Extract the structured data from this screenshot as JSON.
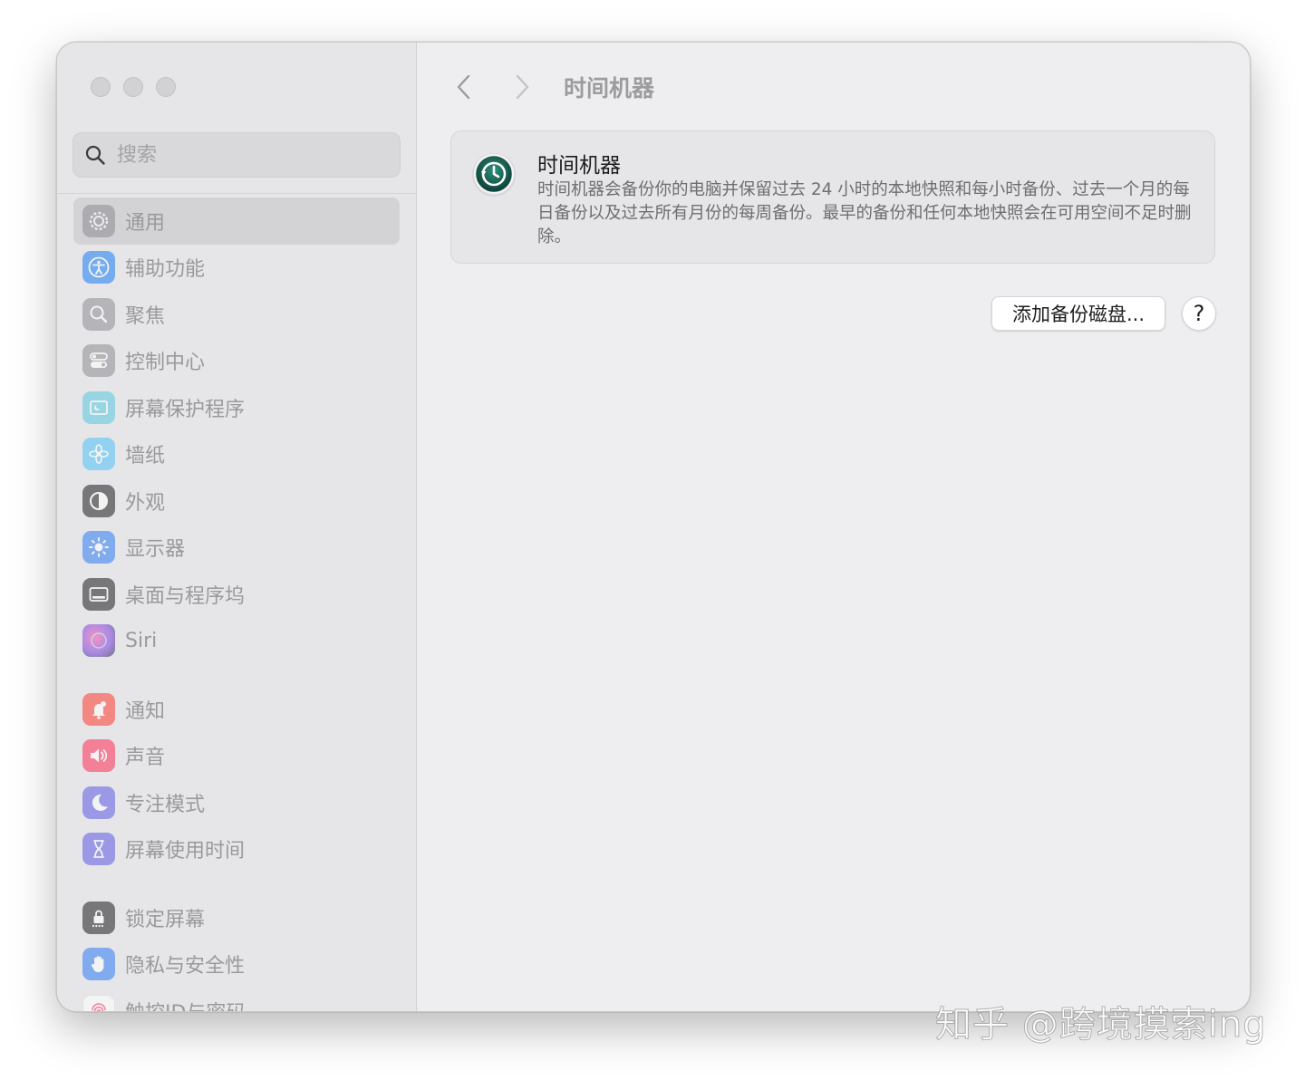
{
  "window": {
    "traffic_lights": [
      "close",
      "minimize",
      "zoom"
    ]
  },
  "search": {
    "placeholder": "搜索",
    "icon": "search-icon"
  },
  "sidebar": {
    "items": [
      {
        "label": "通用",
        "icon": "gear-icon",
        "color": "#8e8e93",
        "active": true
      },
      {
        "label": "辅助功能",
        "icon": "accessibility-icon",
        "color": "#1a7cf5"
      },
      {
        "label": "聚焦",
        "icon": "spotlight-icon",
        "color": "#8e8e93"
      },
      {
        "label": "控制中心",
        "icon": "control-center-icon",
        "color": "#8e8e93"
      },
      {
        "label": "屏幕保护程序",
        "icon": "screensaver-icon",
        "color": "#5ac8e0"
      },
      {
        "label": "墙纸",
        "icon": "wallpaper-icon",
        "color": "#4fc3f7"
      },
      {
        "label": "外观",
        "icon": "appearance-icon",
        "color": "#1d1d1f"
      },
      {
        "label": "显示器",
        "icon": "display-icon",
        "color": "#2f7cf6"
      },
      {
        "label": "桌面与程序坞",
        "icon": "dock-icon",
        "color": "#1d1d1f"
      },
      {
        "label": "Siri",
        "icon": "siri-icon",
        "color": "#7b3fe4"
      },
      {
        "label": "通知",
        "icon": "bell-icon",
        "color": "#ff3b30"
      },
      {
        "label": "声音",
        "icon": "speaker-icon",
        "color": "#ff2d55"
      },
      {
        "label": "专注模式",
        "icon": "moon-icon",
        "color": "#5e5ce6"
      },
      {
        "label": "屏幕使用时间",
        "icon": "hourglass-icon",
        "color": "#5e5ce6"
      },
      {
        "label": "锁定屏幕",
        "icon": "lock-icon",
        "color": "#1d1d1f"
      },
      {
        "label": "隐私与安全性",
        "icon": "hand-icon",
        "color": "#2f7cf6"
      },
      {
        "label": "触控ID与密码",
        "icon": "fingerprint-icon",
        "color": "#ff2d55"
      }
    ]
  },
  "toolbar": {
    "back_icon": "chevron-left-icon",
    "forward_icon": "chevron-right-icon",
    "title": "时间机器"
  },
  "card": {
    "icon": "time-machine-icon",
    "title": "时间机器",
    "description": "时间机器会备份你的电脑并保留过去 24 小时的本地快照和每小时备份、过去一个月的每日备份以及过去所有月份的每周备份。最早的备份和任何本地快照会在可用空间不足时删除。"
  },
  "actions": {
    "add_disk_label": "添加备份磁盘...",
    "help_label": "?"
  },
  "watermark": "知乎 @跨境摸索ing"
}
